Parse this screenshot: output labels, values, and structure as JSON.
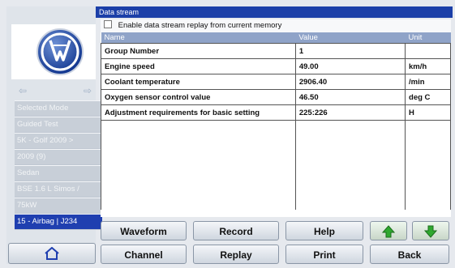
{
  "window": {
    "title": "Data stream"
  },
  "replay_option": {
    "label": "Enable data stream replay from current memory",
    "checked": false
  },
  "table": {
    "headers": {
      "name": "Name",
      "value": "Value",
      "unit": "Unit"
    },
    "rows": [
      {
        "name": "Group Number",
        "value": "1",
        "unit": ""
      },
      {
        "name": "Engine speed",
        "value": "49.00",
        "unit": "km/h"
      },
      {
        "name": "Coolant temperature",
        "value": "2906.40",
        "unit": "/min"
      },
      {
        "name": "Oxygen sensor control value",
        "value": "46.50",
        "unit": "deg C"
      },
      {
        "name": "Adjustment requirements for basic setting",
        "value": "225:226",
        "unit": "H"
      }
    ]
  },
  "sidebar": {
    "items": [
      {
        "label": "Selected Mode"
      },
      {
        "label": "Guided Test"
      },
      {
        "label": "5K - Golf  2009 >"
      },
      {
        "label": "2009 (9)"
      },
      {
        "label": "Sedan"
      },
      {
        "label": "BSE 1.6 L Simos /"
      },
      {
        "label": "75kW"
      },
      {
        "label": "15 - Airbag | J234"
      }
    ]
  },
  "buttons": {
    "waveform": "Waveform",
    "record": "Record",
    "help": "Help",
    "channel": "Channel",
    "replay": "Replay",
    "print": "Print",
    "back": "Back"
  },
  "icons": {
    "up": "arrow-up-icon",
    "down": "arrow-down-icon",
    "home": "home-icon",
    "logo": "vw-logo"
  },
  "colors": {
    "accent": "#1f3fb0",
    "header": "#8fa3c8",
    "arrow": "#2fa82f"
  }
}
